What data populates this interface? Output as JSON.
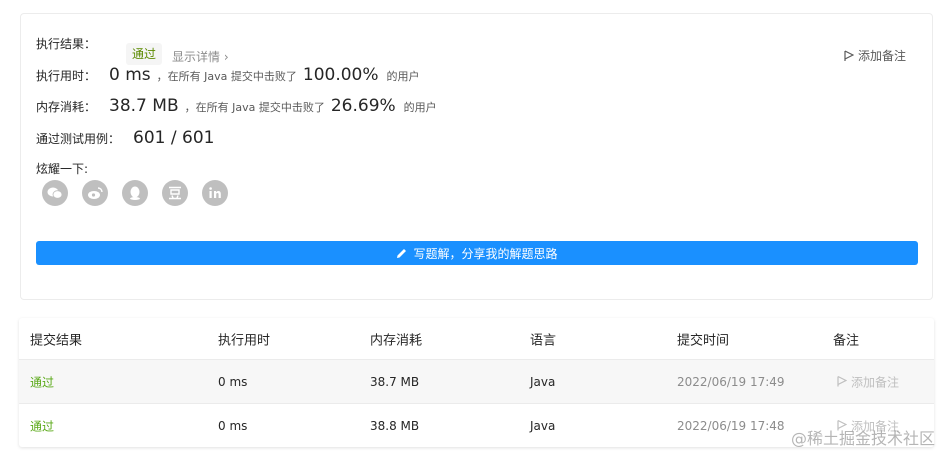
{
  "result": {
    "label": "执行结果：",
    "status": "通过",
    "details": "显示详情 ›",
    "add_note": "添加备注",
    "runtime": {
      "label": "执行用时：",
      "value": "0 ms",
      "mid": "，在所有 Java 提交中击败了",
      "percent": "100.00%",
      "suffix": "的用户"
    },
    "memory": {
      "label": "内存消耗：",
      "value": "38.7 MB",
      "mid": "，在所有 Java 提交中击败了",
      "percent": "26.69%",
      "suffix": "的用户"
    },
    "tests": {
      "label": "通过测试用例：",
      "value": "601 / 601"
    },
    "share_label": "炫耀一下:",
    "share_icons": [
      "wechat-icon",
      "weibo-icon",
      "qq-icon",
      "douban-icon",
      "linkedin-icon"
    ],
    "write_button": "写题解，分享我的解题思路"
  },
  "table": {
    "headers": [
      "提交结果",
      "执行用时",
      "内存消耗",
      "语言",
      "提交时间",
      "备注"
    ],
    "rows": [
      {
        "status": "通过",
        "runtime": "0 ms",
        "memory": "38.7 MB",
        "language": "Java",
        "time": "2022/06/19 17:49",
        "note": "添加备注"
      },
      {
        "status": "通过",
        "runtime": "0 ms",
        "memory": "38.8 MB",
        "language": "Java",
        "time": "2022/06/19 17:48",
        "note": "添加备注"
      }
    ]
  },
  "watermark": "@稀土掘金技术社区",
  "colors": {
    "accent": "#1a90ff",
    "pass": "#5aa918"
  }
}
